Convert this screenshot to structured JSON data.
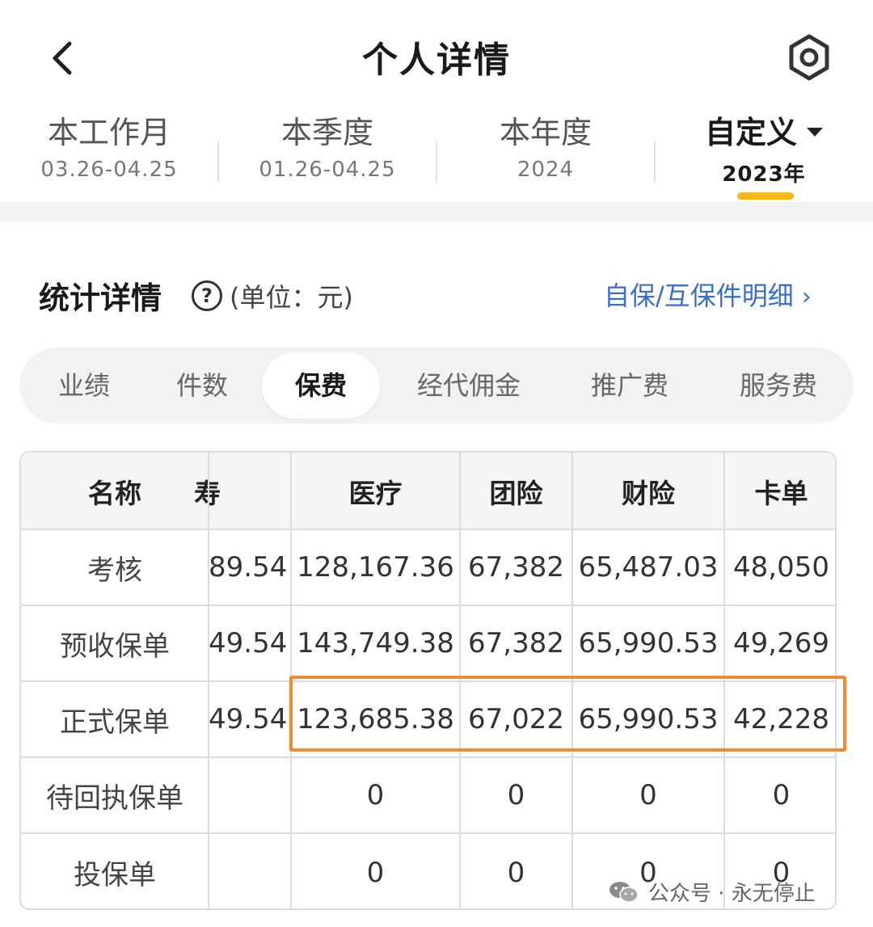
{
  "header": {
    "title": "个人详情"
  },
  "periods": [
    {
      "label": "本工作月",
      "date": "03.26-04.25"
    },
    {
      "label": "本季度",
      "date": "01.26-04.25"
    },
    {
      "label": "本年度",
      "date": "2024"
    },
    {
      "label": "自定义",
      "date": "2023年"
    }
  ],
  "section": {
    "title": "统计详情",
    "help": "?",
    "unit": "(单位：元)",
    "detail_link": "自保/互保件明细"
  },
  "metrics": [
    "业绩",
    "件数",
    "保费",
    "经代佣金",
    "推广费",
    "服务费"
  ],
  "metrics_active": "保费",
  "table": {
    "headers": [
      "名称",
      "寿",
      "医疗",
      "团险",
      "财险",
      "卡单"
    ],
    "rows": [
      {
        "name": "考核",
        "cells": [
          "89.54",
          "128,167.36",
          "67,382",
          "65,487.03",
          "48,050"
        ]
      },
      {
        "name": "预收保单",
        "cells": [
          "49.54",
          "143,749.38",
          "67,382",
          "65,990.53",
          "49,269"
        ]
      },
      {
        "name": "正式保单",
        "cells": [
          "49.54",
          "123,685.38",
          "67,022",
          "65,990.53",
          "42,228"
        ]
      },
      {
        "name": "待回执保单",
        "cells": [
          "",
          "0",
          "0",
          "0",
          "0"
        ]
      },
      {
        "name": "投保单",
        "cells": [
          "",
          "0",
          "0",
          "0",
          "0"
        ]
      }
    ]
  },
  "highlighted_row": "正式保单",
  "footer": {
    "text": "公众号 · 永无停止"
  },
  "colors": {
    "accent_underline": "#f6b81a",
    "link": "#3a6fc4",
    "highlight_border": "#f08a34"
  }
}
